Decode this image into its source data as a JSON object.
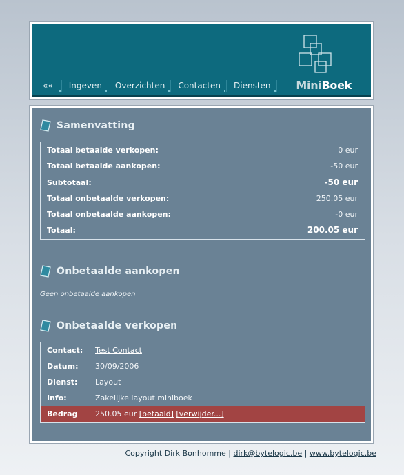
{
  "nav": {
    "items": [
      {
        "label": "««"
      },
      {
        "label": "Ingeven"
      },
      {
        "label": "Overzichten"
      },
      {
        "label": "Contacten"
      },
      {
        "label": "Diensten"
      }
    ]
  },
  "logo": {
    "mini": "Mini",
    "boek": "Boek"
  },
  "summary": {
    "title": "Samenvatting",
    "rows": [
      {
        "label": "Totaal betaalde verkopen:",
        "value": "0 eur"
      },
      {
        "label": "Totaal betaalde aankopen:",
        "value": "-50 eur"
      },
      {
        "label": "Subtotaal:",
        "value": "-50 eur"
      },
      {
        "label": "Totaal onbetaalde verkopen:",
        "value": "250.05 eur"
      },
      {
        "label": "Totaal onbetaalde aankopen:",
        "value": "-0 eur"
      },
      {
        "label": "Totaal:",
        "value": "200.05 eur"
      }
    ]
  },
  "unpaid_purchases": {
    "title": "Onbetaalde aankopen",
    "note": "Geen onbetaalde aankopen"
  },
  "unpaid_sales": {
    "title": "Onbetaalde verkopen",
    "contact_label": "Contact:",
    "contact_value": "Test Contact",
    "date_label": "Datum:",
    "date_value": "30/09/2006",
    "service_label": "Dienst:",
    "service_value": "Layout",
    "info_label": "Info:",
    "info_value": "Zakelijke layout miniboek",
    "amount_label": "Bedrag",
    "amount_value": "250.05 eur",
    "paid_link": "[betaald]",
    "delete_link": "[verwijder...]"
  },
  "footer": {
    "copyright": "Copyright Dirk Bonhomme",
    "sep": "|",
    "email": "dirk@bytelogic.be",
    "site": "www.bytelogic.be"
  },
  "colors": {
    "header_bg": "#0d6a7e",
    "main_bg": "#6a8295",
    "highlight": "#a24443"
  }
}
